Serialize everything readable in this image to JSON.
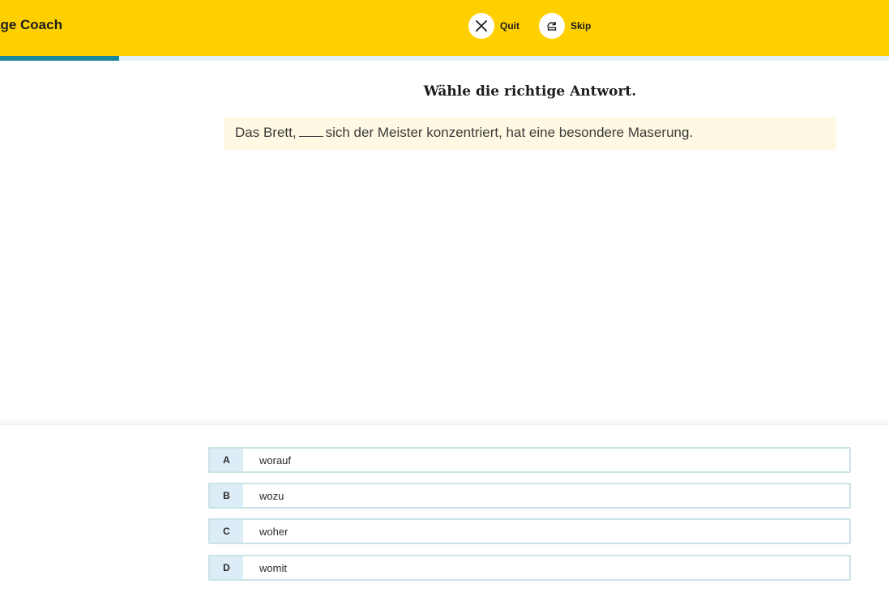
{
  "header": {
    "app_title": "age Coach",
    "quit_label": "Quit",
    "skip_label": "Skip",
    "background_color": "#ffd000"
  },
  "progress": {
    "fraction": 0.134,
    "fill_color": "#1b8aa0"
  },
  "question": {
    "instruction": "Wähle die richtige Antwort.",
    "sentence_before": "Das Brett,",
    "sentence_after": "sich der Meister konzentriert, hat eine besondere Maserung."
  },
  "options": [
    {
      "letter": "A",
      "text": "worauf"
    },
    {
      "letter": "B",
      "text": "wozu"
    },
    {
      "letter": "C",
      "text": "woher"
    },
    {
      "letter": "D",
      "text": "womit"
    }
  ],
  "icons": {
    "quit": "close-icon",
    "skip": "skip-icon"
  }
}
